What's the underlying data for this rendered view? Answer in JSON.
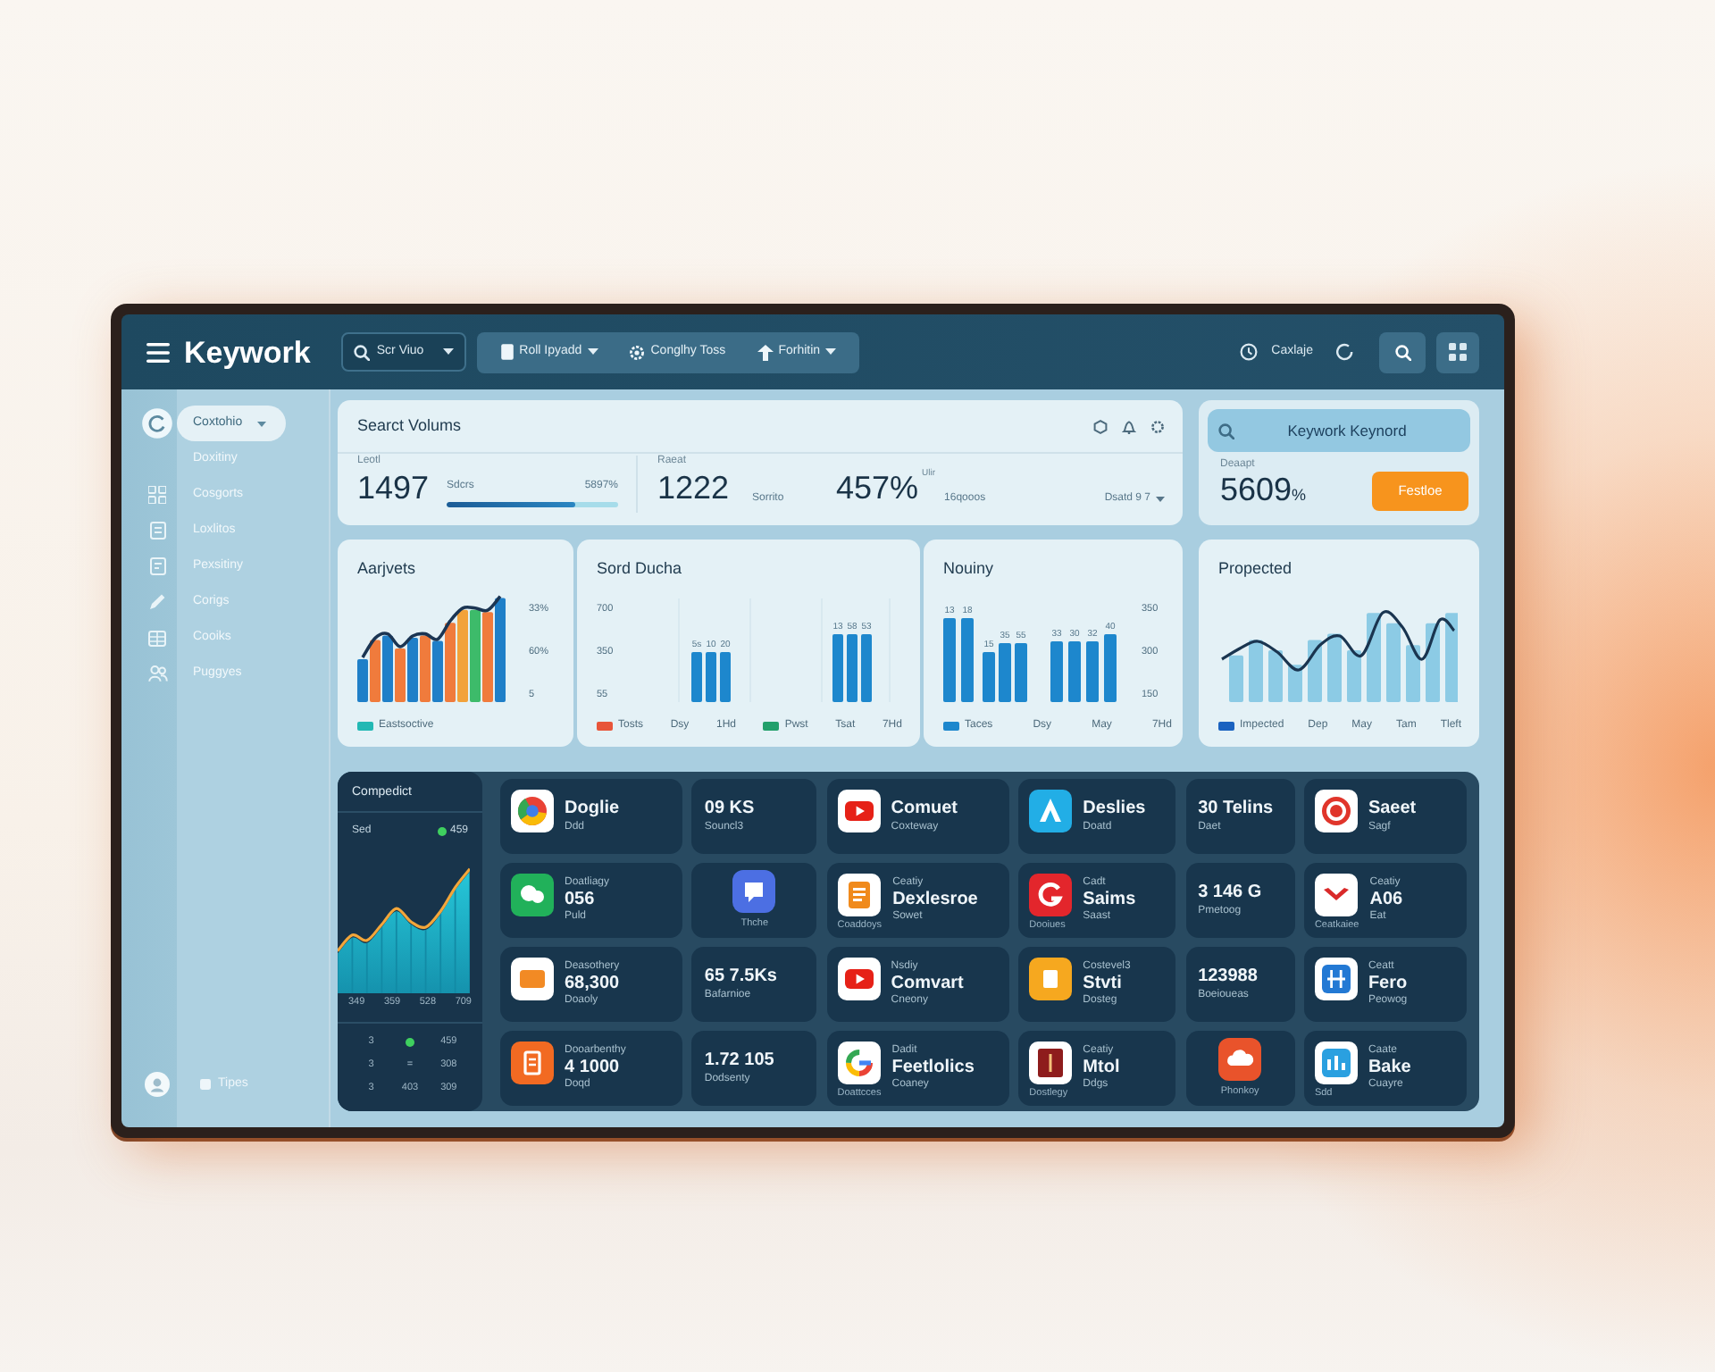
{
  "topbar": {
    "logo": "Keywork",
    "search": {
      "label": "Scr Viuo",
      "dropdown": true
    },
    "menu": [
      {
        "label": "Roll Ipyadd",
        "dropdown": true
      },
      {
        "label": "Conglhy Toss",
        "dropdown": false
      },
      {
        "label": "Forhitin",
        "dropdown": true
      }
    ],
    "user": "Caxlaje"
  },
  "sidebar": {
    "items": [
      {
        "label": "Coxtohio",
        "selected": true
      },
      {
        "label": "Doxitiny",
        "selected": false
      },
      {
        "label": "Cosgorts",
        "selected": false
      },
      {
        "label": "Loxlitos",
        "selected": false
      },
      {
        "label": "Pexsitiny",
        "selected": false
      },
      {
        "label": "Corigs",
        "selected": false
      },
      {
        "label": "Cooiks",
        "selected": false
      },
      {
        "label": "Puggyes",
        "selected": false
      }
    ],
    "footer": "Tipes"
  },
  "search_volume": {
    "title": "Searct Volums",
    "stats": [
      {
        "label": "Leotl",
        "value": "1497",
        "note": "Sdcrs",
        "reading": "5897%",
        "level": 0.75
      },
      {
        "label": "Raeat",
        "value": "1222",
        "note": "Sorrito"
      },
      {
        "value": "457%$^{Ulir}$",
        "note": "16qooos"
      }
    ],
    "range": {
      "label": "Dsatd 9 7",
      "dropdown": true
    }
  },
  "keyword_card": {
    "button": "Keywork Keynord",
    "label": "Deaapt",
    "value": "5609$_{%}$",
    "action": "Festloe"
  },
  "charts": [
    {
      "kind": "mixed",
      "title": "Aarjvets",
      "ticks": [
        "33%",
        "60%",
        "5"
      ],
      "footer": [
        {
          "label": "Eastsoctive",
          "color": "#22b8b4"
        }
      ]
    },
    {
      "kind": "grouped",
      "title": "Sord Ducha",
      "ticks": [
        "700",
        "350",
        "55"
      ],
      "bar_labels": [
        "5s",
        "10",
        "20",
        "13",
        "58",
        "53"
      ],
      "footer": [
        {
          "label": "Tosts",
          "color": "#e8553a"
        },
        {
          "label": "Dsy"
        },
        {
          "label": "1Hd"
        },
        {
          "label": "Pwst",
          "color": "#22a06b"
        },
        {
          "label": "Tsat"
        },
        {
          "label": "7Hd"
        }
      ]
    },
    {
      "kind": "columns",
      "title": "Nouiny",
      "ticks": [
        "350",
        "300",
        "150"
      ],
      "bar_labels": [
        "13",
        "18",
        "15",
        "35",
        "55",
        "33",
        "30",
        "32",
        "40"
      ],
      "footer": [
        {
          "label": "Taces",
          "color": "#1d87cd"
        },
        {
          "label": "Dsy"
        },
        {
          "label": "May"
        },
        {
          "label": "7Hd"
        }
      ]
    },
    {
      "kind": "trend",
      "title": "Propected",
      "footer": [
        {
          "label": "Impected",
          "color": "#1a62c0"
        },
        {
          "label": "Dep"
        },
        {
          "label": "May"
        },
        {
          "label": "Tam"
        },
        {
          "label": "Tleft"
        }
      ]
    }
  ],
  "competitor": {
    "title": "Compedict",
    "status": {
      "label": "Sed",
      "value": "459",
      "color": "#3fd05f"
    },
    "x_labels": [
      "349",
      "359",
      "528",
      "709"
    ],
    "rows": [
      {
        "cells": [
          {
            "text": "3"
          },
          {
            "color": "#3fd05f"
          },
          {
            "text": "459"
          }
        ]
      },
      {
        "cells": [
          {
            "text": "3"
          },
          {
            "text": "="
          },
          {
            "text": "308"
          }
        ]
      },
      {
        "cells": [
          {
            "text": "3"
          },
          {
            "text": "403"
          },
          {
            "text": "309"
          }
        ]
      }
    ]
  },
  "tiles": [
    {
      "kind": "app",
      "value": "Doglie",
      "sub": "Ddd"
    },
    {
      "kind": "stat",
      "value": "09 KS",
      "sub": "Souncl3"
    },
    {
      "kind": "app",
      "value": "Comuet",
      "sub": "Coxteway"
    },
    {
      "kind": "app",
      "value": "Deslies",
      "sub": "Doatd"
    },
    {
      "kind": "stat",
      "value": "30 Telins",
      "sub": "Daet"
    },
    {
      "kind": "app",
      "value": "Saeet",
      "sub": "Sagf"
    },
    {
      "kind": "app",
      "label": "Doatliagy",
      "value": "056",
      "sub": "Puld"
    },
    {
      "kind": "logo",
      "caption": "Thche"
    },
    {
      "kind": "app",
      "label": "Ceatiy",
      "value": "Dexlesroe",
      "sub": "Sowet",
      "caption": "Coaddoys"
    },
    {
      "kind": "app",
      "label": "Cadt",
      "value": "Saims",
      "sub": "Saast",
      "caption": "Dooiues"
    },
    {
      "kind": "stat",
      "value": "3 146 G",
      "sub": "Pmetoog"
    },
    {
      "kind": "app",
      "label": "Ceatiy",
      "value": "A06",
      "sub": "Eat",
      "caption": "Ceatkaiee"
    },
    {
      "kind": "app",
      "label": "Deasothery",
      "value": "68,300",
      "sub": "Doaoly"
    },
    {
      "kind": "stat",
      "value": "65 7.5Ks",
      "sub": "Bafarnioe"
    },
    {
      "kind": "app",
      "label": "Nsdiy",
      "value": "Comvart",
      "sub": "Cneony"
    },
    {
      "kind": "app",
      "label": "Costevel3",
      "value": "Stvti",
      "sub": "Dosteg"
    },
    {
      "kind": "stat",
      "value": "123988",
      "sub": "Boeioueas"
    },
    {
      "kind": "app",
      "label": "Ceatt",
      "value": "Fero",
      "sub": "Peowog"
    },
    {
      "kind": "app",
      "label": "Dooarbenthy",
      "value": "4 1000",
      "sub": "Doqd"
    },
    {
      "kind": "stat",
      "value": "1.72 105",
      "sub": "Dodsenty"
    },
    {
      "kind": "app",
      "label": "Dadit",
      "value": "Feetlolics",
      "sub": "Coaney",
      "caption": "Doattcces"
    },
    {
      "kind": "app",
      "label": "Ceatiy",
      "value": "Mtol",
      "sub": "Ddgs",
      "caption": "Dostlegy"
    },
    {
      "kind": "logo",
      "caption": "Phonkoy"
    },
    {
      "kind": "app",
      "label": "Caate",
      "value": "Bake",
      "sub": "Cuayre",
      "caption": "Sdd"
    }
  ]
}
